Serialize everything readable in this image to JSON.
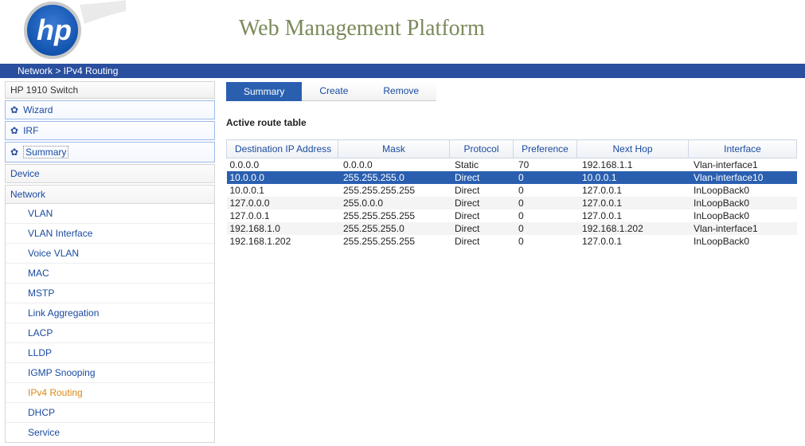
{
  "header": {
    "title": "Web Management Platform"
  },
  "breadcrumb": "Network > IPv4 Routing",
  "sidebar": {
    "device_title": "HP 1910 Switch",
    "top_items": [
      {
        "label": "Wizard"
      },
      {
        "label": "IRF"
      },
      {
        "label": "Summary"
      }
    ],
    "sections": {
      "device_label": "Device",
      "network_label": "Network"
    },
    "network_items": [
      "VLAN",
      "VLAN Interface",
      "Voice VLAN",
      "MAC",
      "MSTP",
      "Link Aggregation",
      "LACP",
      "LLDP",
      "IGMP Snooping",
      "IPv4 Routing",
      "DHCP",
      "Service"
    ],
    "network_active_index": 9
  },
  "tabs": [
    {
      "label": "Summary",
      "active": true
    },
    {
      "label": "Create",
      "active": false
    },
    {
      "label": "Remove",
      "active": false
    }
  ],
  "section_title": "Active route table",
  "table": {
    "headers": [
      "Destination IP Address",
      "Mask",
      "Protocol",
      "Preference",
      "Next Hop",
      "Interface"
    ],
    "rows": [
      {
        "cells": [
          "0.0.0.0",
          "0.0.0.0",
          "Static",
          "70",
          "192.168.1.1",
          "Vlan-interface1"
        ],
        "selected": false
      },
      {
        "cells": [
          "10.0.0.0",
          "255.255.255.0",
          "Direct",
          "0",
          "10.0.0.1",
          "Vlan-interface10"
        ],
        "selected": true
      },
      {
        "cells": [
          "10.0.0.1",
          "255.255.255.255",
          "Direct",
          "0",
          "127.0.0.1",
          "InLoopBack0"
        ],
        "selected": false
      },
      {
        "cells": [
          "127.0.0.0",
          "255.0.0.0",
          "Direct",
          "0",
          "127.0.0.1",
          "InLoopBack0"
        ],
        "selected": false
      },
      {
        "cells": [
          "127.0.0.1",
          "255.255.255.255",
          "Direct",
          "0",
          "127.0.0.1",
          "InLoopBack0"
        ],
        "selected": false
      },
      {
        "cells": [
          "192.168.1.0",
          "255.255.255.0",
          "Direct",
          "0",
          "192.168.1.202",
          "Vlan-interface1"
        ],
        "selected": false
      },
      {
        "cells": [
          "192.168.1.202",
          "255.255.255.255",
          "Direct",
          "0",
          "127.0.0.1",
          "InLoopBack0"
        ],
        "selected": false
      }
    ]
  }
}
